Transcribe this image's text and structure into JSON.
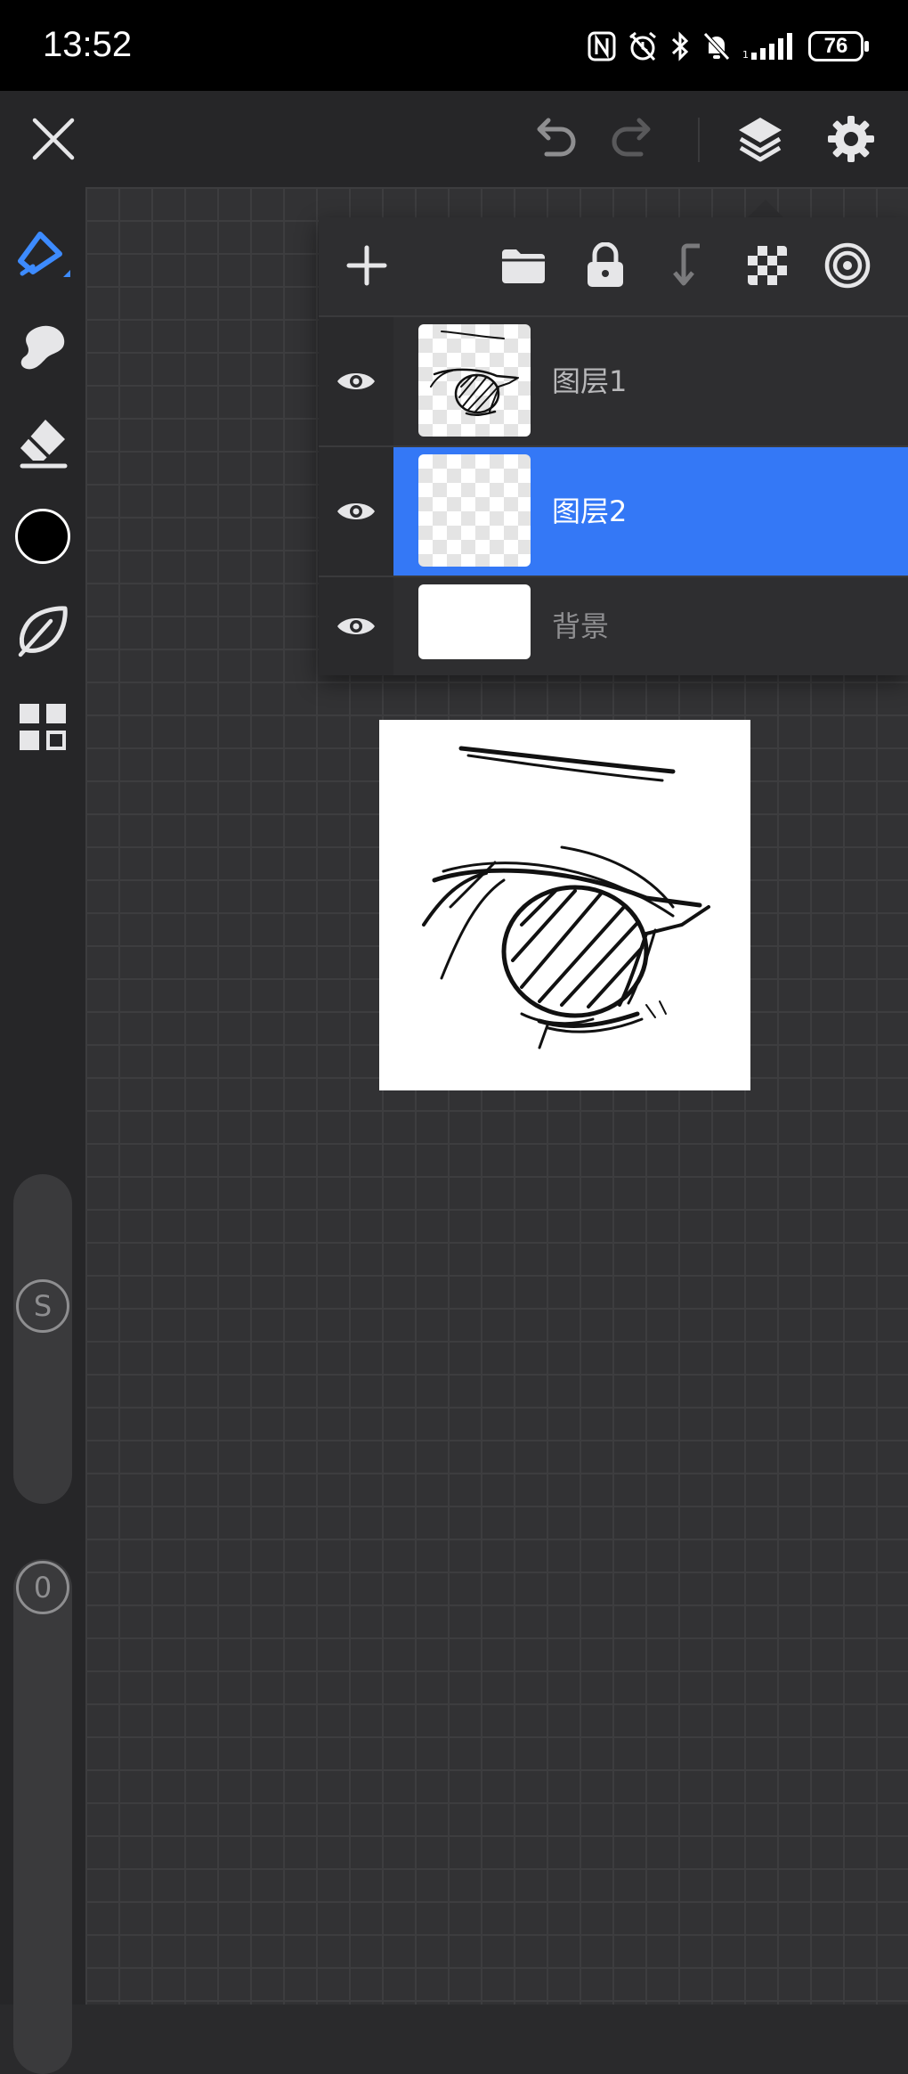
{
  "status_bar": {
    "time": "13:52",
    "battery": "76",
    "icons": [
      "nfc-icon",
      "alarm-icon",
      "bluetooth-icon",
      "mute-icon",
      "signal-icon"
    ]
  },
  "top_bar": {
    "buttons": [
      "close-icon",
      "undo-icon",
      "redo-icon",
      "layers-icon",
      "settings-icon"
    ]
  },
  "left_toolbar": {
    "tools": [
      "pen-icon",
      "smudge-icon",
      "eraser-icon",
      "color-swatch",
      "leaf-brush-icon",
      "grid-menu-icon"
    ],
    "current_color": "#000000",
    "size_slider_label": "S",
    "opacity_slider_label": "0"
  },
  "layer_panel": {
    "toolbar": [
      "add-icon",
      "folder-icon",
      "lock-icon",
      "merge-down-icon",
      "transparency-icon",
      "target-icon"
    ],
    "layers": [
      {
        "name": "图层1",
        "visible": true,
        "selected": false
      },
      {
        "name": "图层2",
        "visible": true,
        "selected": true
      },
      {
        "name": "背景",
        "visible": true,
        "selected": false
      }
    ],
    "selection_color": "#3478f6"
  }
}
